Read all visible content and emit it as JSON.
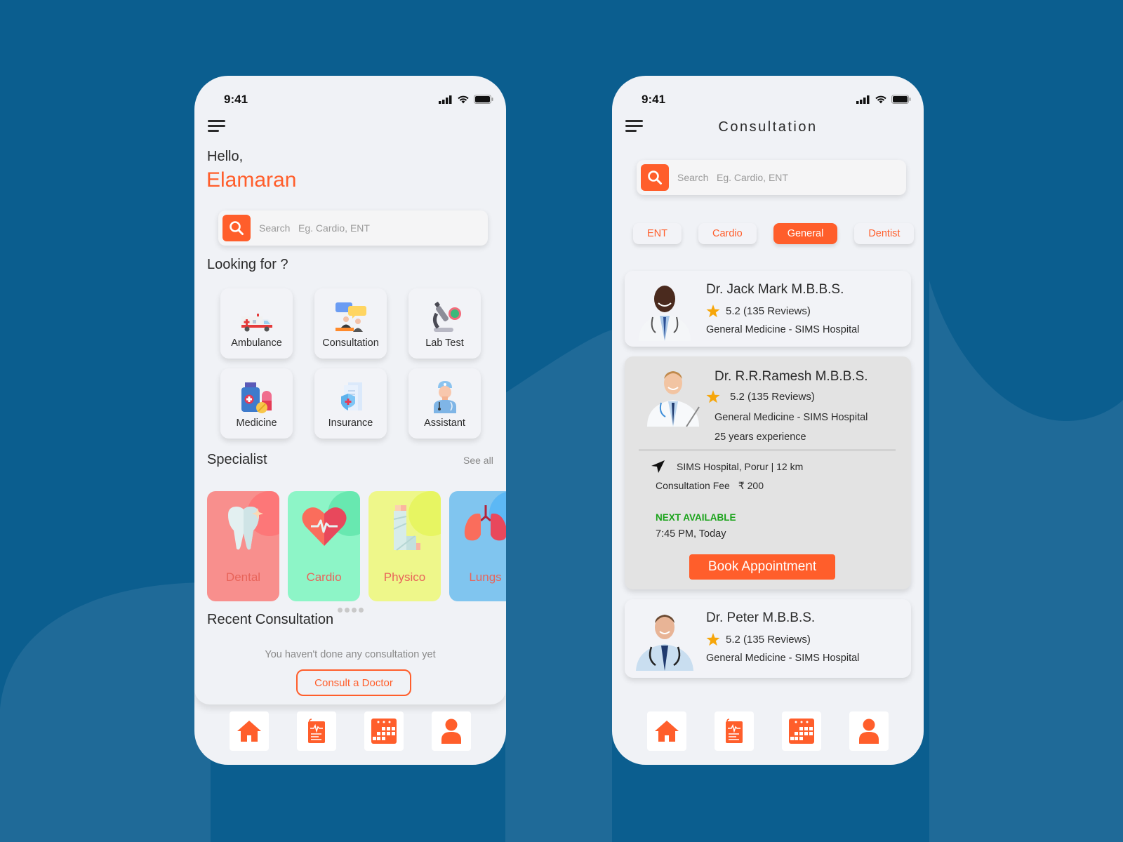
{
  "colors": {
    "background": "#0b5e8f",
    "background_wave": "#1f6a98",
    "accent": "#ff5e2b",
    "success": "#1aa31a",
    "star": "#f6a60a"
  },
  "status_bar": {
    "time": "9:41",
    "icons": [
      "signal-icon",
      "wifi-icon",
      "battery-icon"
    ]
  },
  "home": {
    "greeting": "Hello,",
    "user_name": "Elamaran",
    "search": {
      "placeholder": "Search   Eg. Cardio, ENT"
    },
    "looking_for": {
      "title": "Looking for ?",
      "items": [
        {
          "label": "Ambulance",
          "icon": "ambulance-icon"
        },
        {
          "label": "Consultation",
          "icon": "consultation-icon"
        },
        {
          "label": "Lab Test",
          "icon": "microscope-icon"
        },
        {
          "label": "Medicine",
          "icon": "medicine-icon"
        },
        {
          "label": "Insurance",
          "icon": "insurance-icon"
        },
        {
          "label": "Assistant",
          "icon": "assistant-icon"
        }
      ]
    },
    "specialist": {
      "title": "Specialist",
      "see_all": "See all",
      "items": [
        {
          "label": "Dental",
          "icon": "tooth-icon",
          "color": "#f88f8d",
          "blob": "#fd7778"
        },
        {
          "label": "Cardio",
          "icon": "heart-icon",
          "color": "#8df5c7",
          "blob": "#68e8b0"
        },
        {
          "label": "Physico",
          "icon": "leg-cast-icon",
          "color": "#eef78a",
          "blob": "#e7f562"
        },
        {
          "label": "Lungs",
          "icon": "lungs-icon",
          "color": "#80c5ef",
          "blob": "#5cb8f5"
        }
      ],
      "page_dots": 4
    },
    "recent": {
      "title": "Recent Consultation",
      "empty_message": "You haven't done any consultation yet",
      "cta": "Consult a Doctor"
    }
  },
  "consultation": {
    "title": "Consultation",
    "search": {
      "placeholder": "Search   Eg. Cardio, ENT"
    },
    "filters": [
      {
        "label": "ENT",
        "active": false
      },
      {
        "label": "Cardio",
        "active": false
      },
      {
        "label": "General",
        "active": true
      },
      {
        "label": "Dentist",
        "active": false
      }
    ],
    "doctors": [
      {
        "name": "Dr. Jack Mark M.B.B.S.",
        "rating": "5.2 (135 Reviews)",
        "specialty": "General Medicine - SIMS Hospital"
      },
      {
        "name": "Dr. R.R.Ramesh M.B.B.S.",
        "rating": "5.2 (135 Reviews)",
        "specialty": "General Medicine - SIMS Hospital",
        "experience": "25 years experience",
        "location": "SIMS Hospital, Porur | 12 km",
        "fee_label": "Consultation Fee",
        "fee_value": "₹ 200",
        "next_available_label": "NEXT AVAILABLE",
        "next_available_time": "7:45 PM, Today",
        "cta": "Book Appointment"
      },
      {
        "name": "Dr. Peter M.B.B.S.",
        "rating": "5.2 (135 Reviews)",
        "specialty": "General Medicine - SIMS Hospital"
      }
    ]
  },
  "tabbar": {
    "items": [
      {
        "name": "home",
        "icon": "home-icon"
      },
      {
        "name": "records",
        "icon": "medical-report-icon"
      },
      {
        "name": "appointments",
        "icon": "calendar-icon"
      },
      {
        "name": "profile",
        "icon": "user-icon"
      }
    ]
  }
}
